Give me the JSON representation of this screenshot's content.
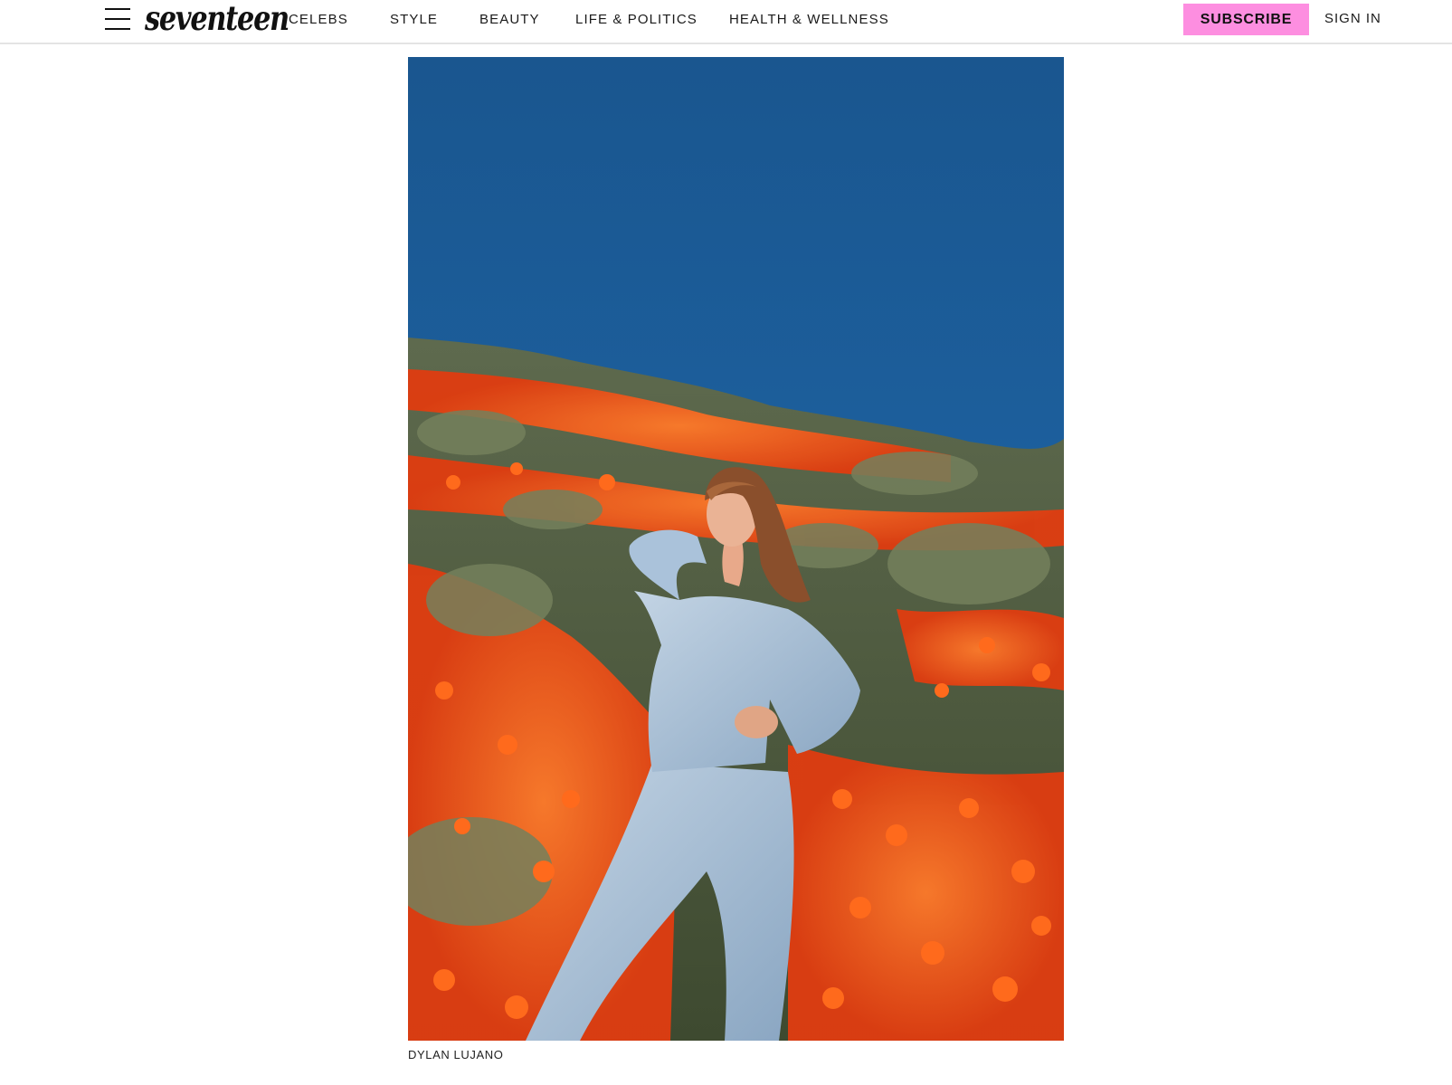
{
  "header": {
    "logo_text": "seventeen",
    "nav_items": [
      {
        "label": "CELEBS"
      },
      {
        "label": "STYLE"
      },
      {
        "label": "BEAUTY"
      },
      {
        "label": "LIFE & POLITICS"
      },
      {
        "label": "HEALTH & WELLNESS"
      }
    ],
    "subscribe_label": "SUBSCRIBE",
    "signin_label": "SIGN IN"
  },
  "photo": {
    "credit": "DYLAN LUJANO"
  },
  "colors": {
    "subscribe_bg": "#fd8ee0",
    "sky": "#1a5f9e",
    "poppies": "#f0501a",
    "shrubs": "#6f7a58",
    "denim": "#a9c1d8"
  }
}
